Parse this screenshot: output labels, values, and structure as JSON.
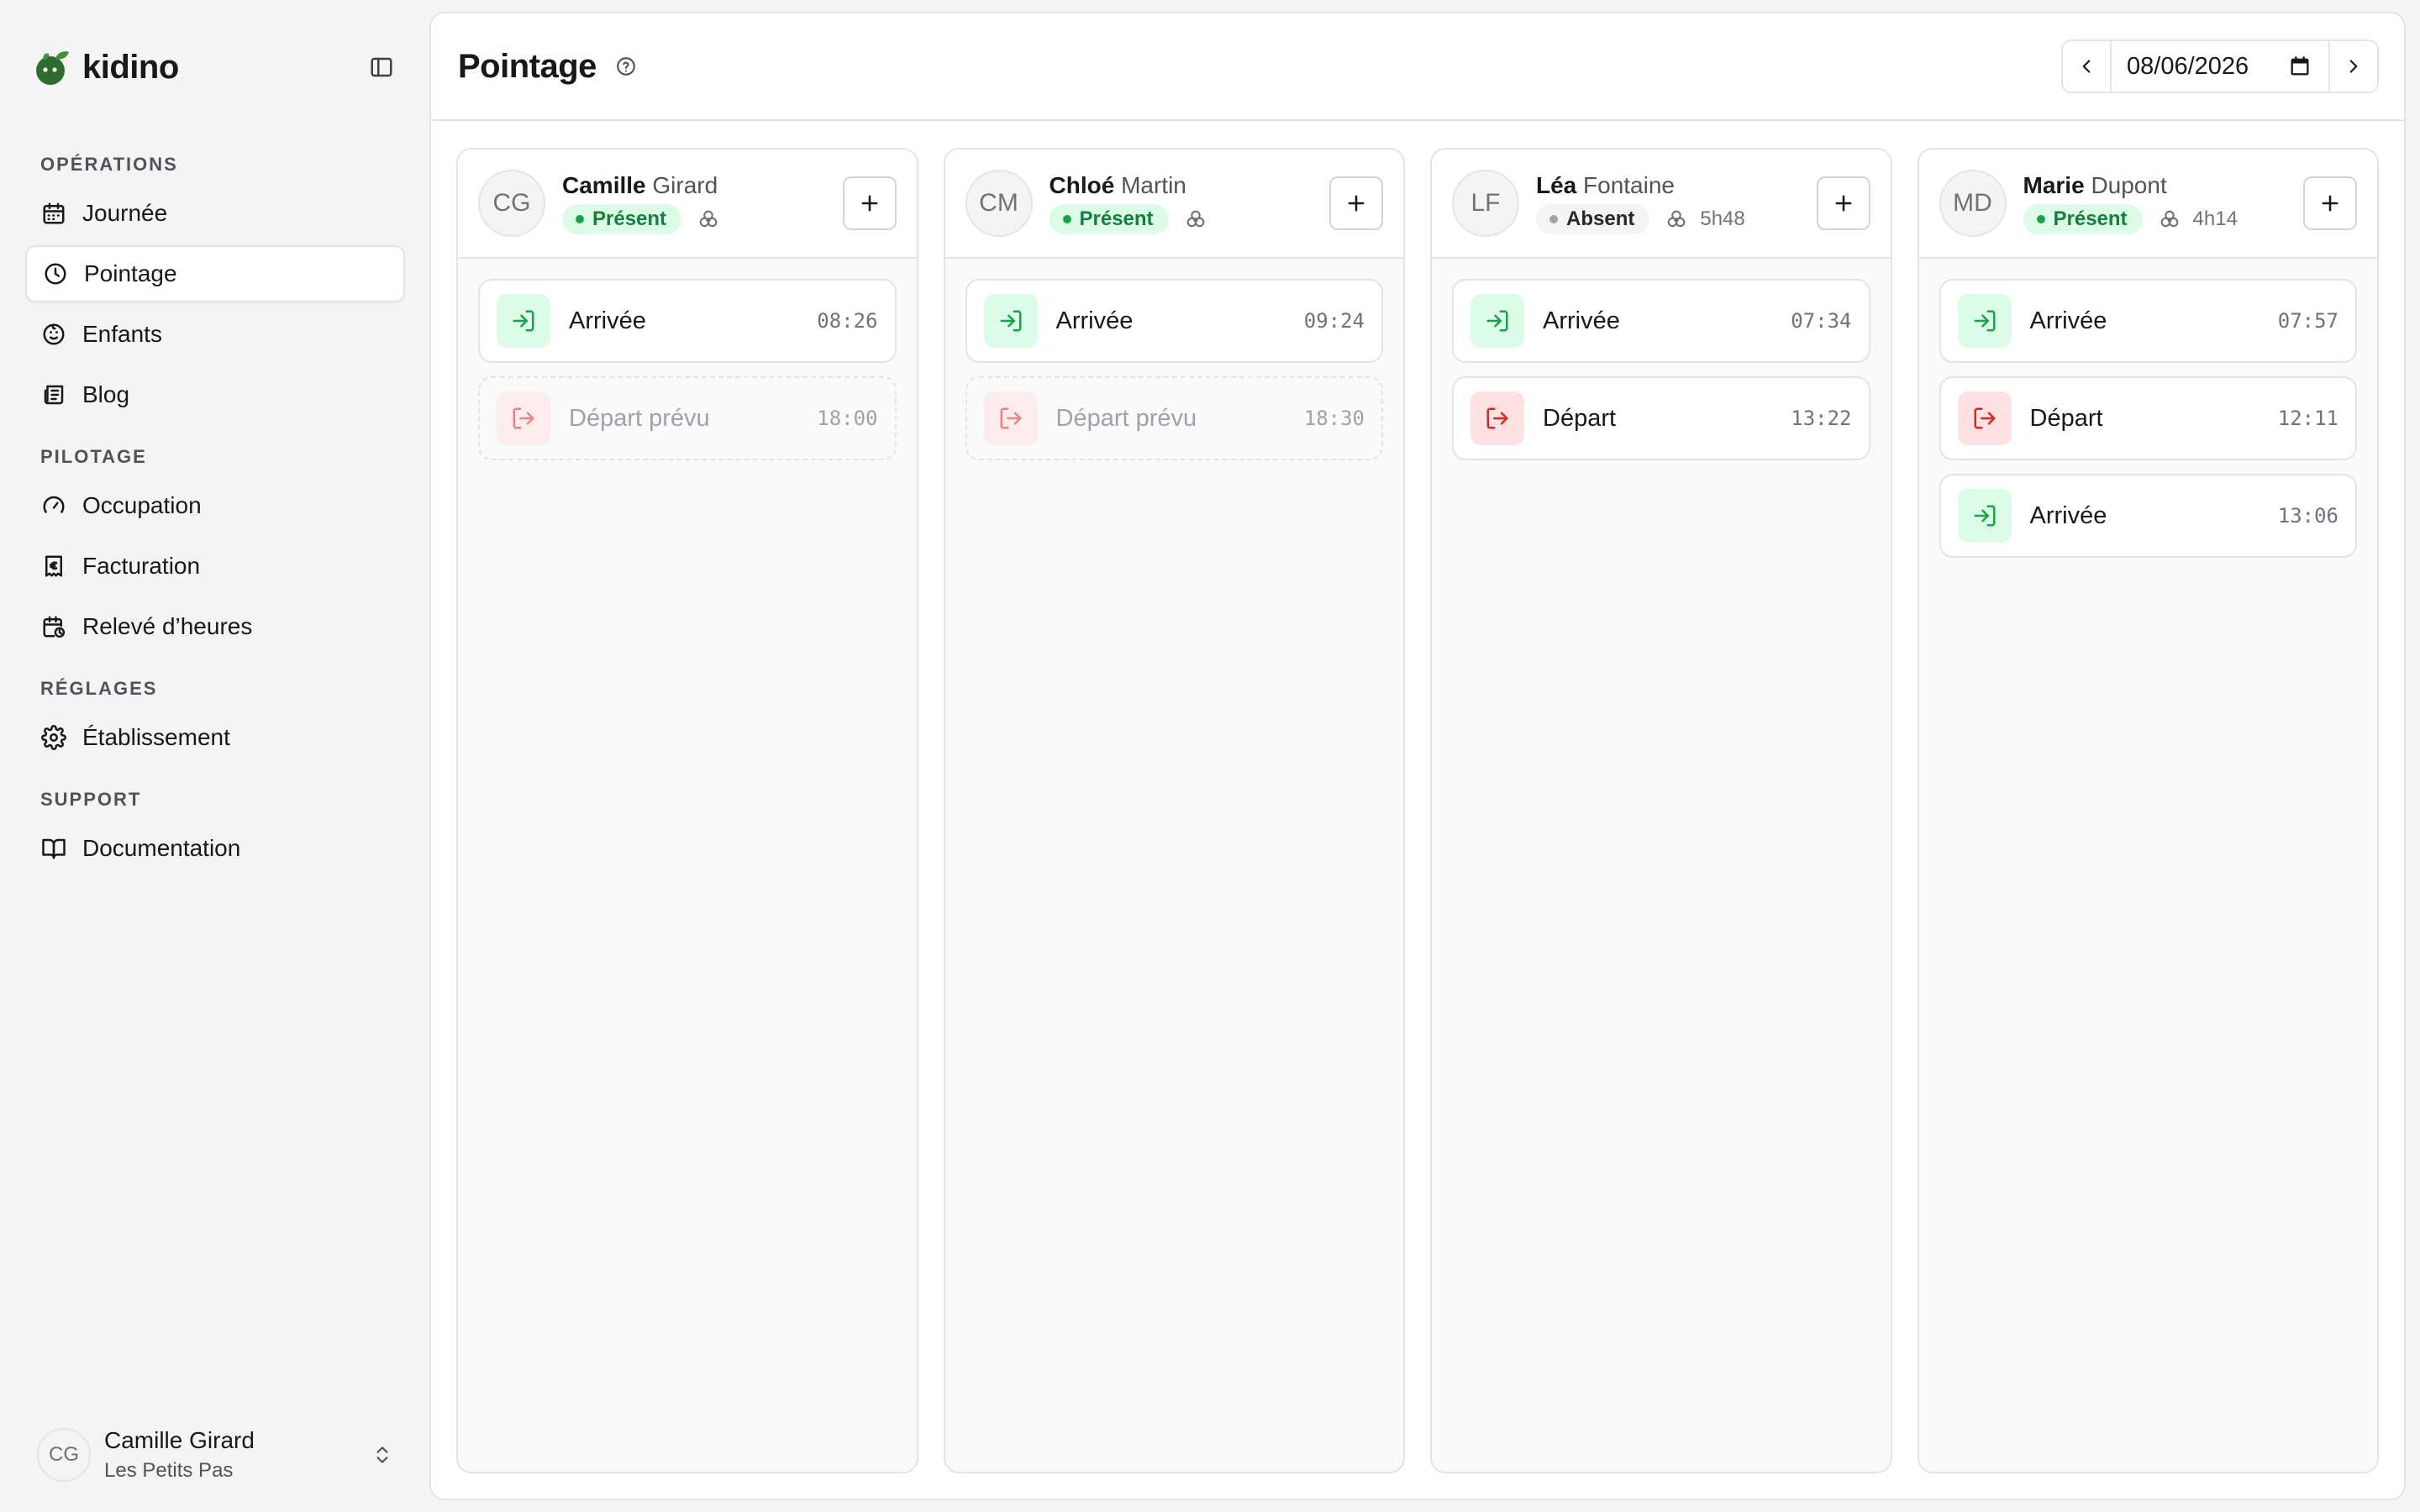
{
  "brand": {
    "name": "kidino",
    "accent": "#2f6b2f"
  },
  "sidebar": {
    "sections": [
      {
        "title": "OPÉRATIONS",
        "items": [
          {
            "label": "Journée",
            "icon": "calendar-icon"
          },
          {
            "label": "Pointage",
            "icon": "clock-icon",
            "active": true
          },
          {
            "label": "Enfants",
            "icon": "baby-face-icon"
          },
          {
            "label": "Blog",
            "icon": "newspaper-icon"
          }
        ]
      },
      {
        "title": "PILOTAGE",
        "items": [
          {
            "label": "Occupation",
            "icon": "gauge-icon"
          },
          {
            "label": "Facturation",
            "icon": "receipt-euro-icon"
          },
          {
            "label": "Relevé d’heures",
            "icon": "calendar-clock-icon"
          }
        ]
      },
      {
        "title": "RÉGLAGES",
        "items": [
          {
            "label": "Établissement",
            "icon": "gear-icon"
          }
        ]
      },
      {
        "title": "SUPPORT",
        "items": [
          {
            "label": "Documentation",
            "icon": "book-icon"
          }
        ]
      }
    ],
    "user": {
      "initials": "CG",
      "name": "Camille Girard",
      "org": "Les Petits Pas"
    }
  },
  "header": {
    "title": "Pointage",
    "date": "08/06/2026"
  },
  "columns": [
    {
      "initials": "CG",
      "first_name": "Camille",
      "last_name": "Girard",
      "status": "Présent",
      "status_type": "present",
      "duration": "",
      "events": [
        {
          "label": "Arrivée",
          "time": "08:26",
          "kind": "in",
          "planned": false
        },
        {
          "label": "Départ prévu",
          "time": "18:00",
          "kind": "out",
          "planned": true
        }
      ]
    },
    {
      "initials": "CM",
      "first_name": "Chloé",
      "last_name": "Martin",
      "status": "Présent",
      "status_type": "present",
      "duration": "",
      "events": [
        {
          "label": "Arrivée",
          "time": "09:24",
          "kind": "in",
          "planned": false
        },
        {
          "label": "Départ prévu",
          "time": "18:30",
          "kind": "out",
          "planned": true
        }
      ]
    },
    {
      "initials": "LF",
      "first_name": "Léa",
      "last_name": "Fontaine",
      "status": "Absent",
      "status_type": "absent",
      "duration": "5h48",
      "events": [
        {
          "label": "Arrivée",
          "time": "07:34",
          "kind": "in",
          "planned": false
        },
        {
          "label": "Départ",
          "time": "13:22",
          "kind": "out",
          "planned": false
        }
      ]
    },
    {
      "initials": "MD",
      "first_name": "Marie",
      "last_name": "Dupont",
      "status": "Présent",
      "status_type": "present",
      "duration": "4h14",
      "events": [
        {
          "label": "Arrivée",
          "time": "07:57",
          "kind": "in",
          "planned": false
        },
        {
          "label": "Départ",
          "time": "12:11",
          "kind": "out",
          "planned": false
        },
        {
          "label": "Arrivée",
          "time": "13:06",
          "kind": "in",
          "planned": false
        }
      ]
    }
  ]
}
